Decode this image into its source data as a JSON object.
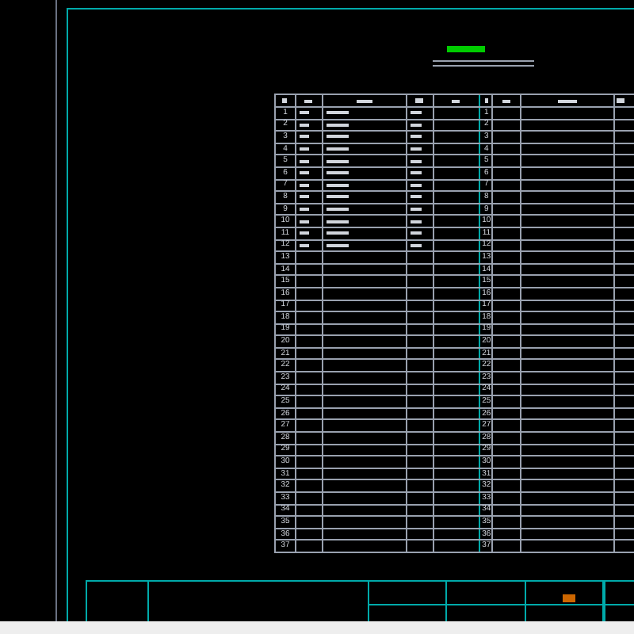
{
  "drawing_list": {
    "rows": [
      {
        "left_no": "1",
        "left_filled": true,
        "right_no": "1"
      },
      {
        "left_no": "2",
        "left_filled": true,
        "right_no": "2"
      },
      {
        "left_no": "3",
        "left_filled": true,
        "right_no": "3"
      },
      {
        "left_no": "4",
        "left_filled": true,
        "right_no": "4"
      },
      {
        "left_no": "5",
        "left_filled": true,
        "right_no": "5"
      },
      {
        "left_no": "6",
        "left_filled": true,
        "right_no": "6"
      },
      {
        "left_no": "7",
        "left_filled": true,
        "right_no": "7"
      },
      {
        "left_no": "8",
        "left_filled": true,
        "right_no": "8"
      },
      {
        "left_no": "9",
        "left_filled": true,
        "right_no": "9"
      },
      {
        "left_no": "10",
        "left_filled": true,
        "right_no": "10"
      },
      {
        "left_no": "11",
        "left_filled": true,
        "right_no": "11"
      },
      {
        "left_no": "12",
        "left_filled": true,
        "right_no": "12"
      },
      {
        "left_no": "13",
        "left_filled": false,
        "right_no": "13"
      },
      {
        "left_no": "14",
        "left_filled": false,
        "right_no": "14"
      },
      {
        "left_no": "15",
        "left_filled": false,
        "right_no": "15"
      },
      {
        "left_no": "16",
        "left_filled": false,
        "right_no": "16"
      },
      {
        "left_no": "17",
        "left_filled": false,
        "right_no": "17"
      },
      {
        "left_no": "18",
        "left_filled": false,
        "right_no": "18"
      },
      {
        "left_no": "19",
        "left_filled": false,
        "right_no": "19"
      },
      {
        "left_no": "20",
        "left_filled": false,
        "right_no": "20"
      },
      {
        "left_no": "21",
        "left_filled": false,
        "right_no": "21"
      },
      {
        "left_no": "22",
        "left_filled": false,
        "right_no": "22"
      },
      {
        "left_no": "23",
        "left_filled": false,
        "right_no": "23"
      },
      {
        "left_no": "24",
        "left_filled": false,
        "right_no": "24"
      },
      {
        "left_no": "25",
        "left_filled": false,
        "right_no": "25"
      },
      {
        "left_no": "26",
        "left_filled": false,
        "right_no": "26"
      },
      {
        "left_no": "27",
        "left_filled": false,
        "right_no": "27"
      },
      {
        "left_no": "28",
        "left_filled": false,
        "right_no": "28"
      },
      {
        "left_no": "29",
        "left_filled": false,
        "right_no": "29"
      },
      {
        "left_no": "30",
        "left_filled": false,
        "right_no": "30"
      },
      {
        "left_no": "31",
        "left_filled": false,
        "right_no": "31"
      },
      {
        "left_no": "32",
        "left_filled": false,
        "right_no": "32"
      },
      {
        "left_no": "33",
        "left_filled": false,
        "right_no": "33"
      },
      {
        "left_no": "34",
        "left_filled": false,
        "right_no": "34"
      },
      {
        "left_no": "35",
        "left_filled": false,
        "right_no": "35"
      },
      {
        "left_no": "36",
        "left_filled": false,
        "right_no": "36"
      },
      {
        "left_no": "37",
        "left_filled": false,
        "right_no": "37"
      }
    ]
  }
}
